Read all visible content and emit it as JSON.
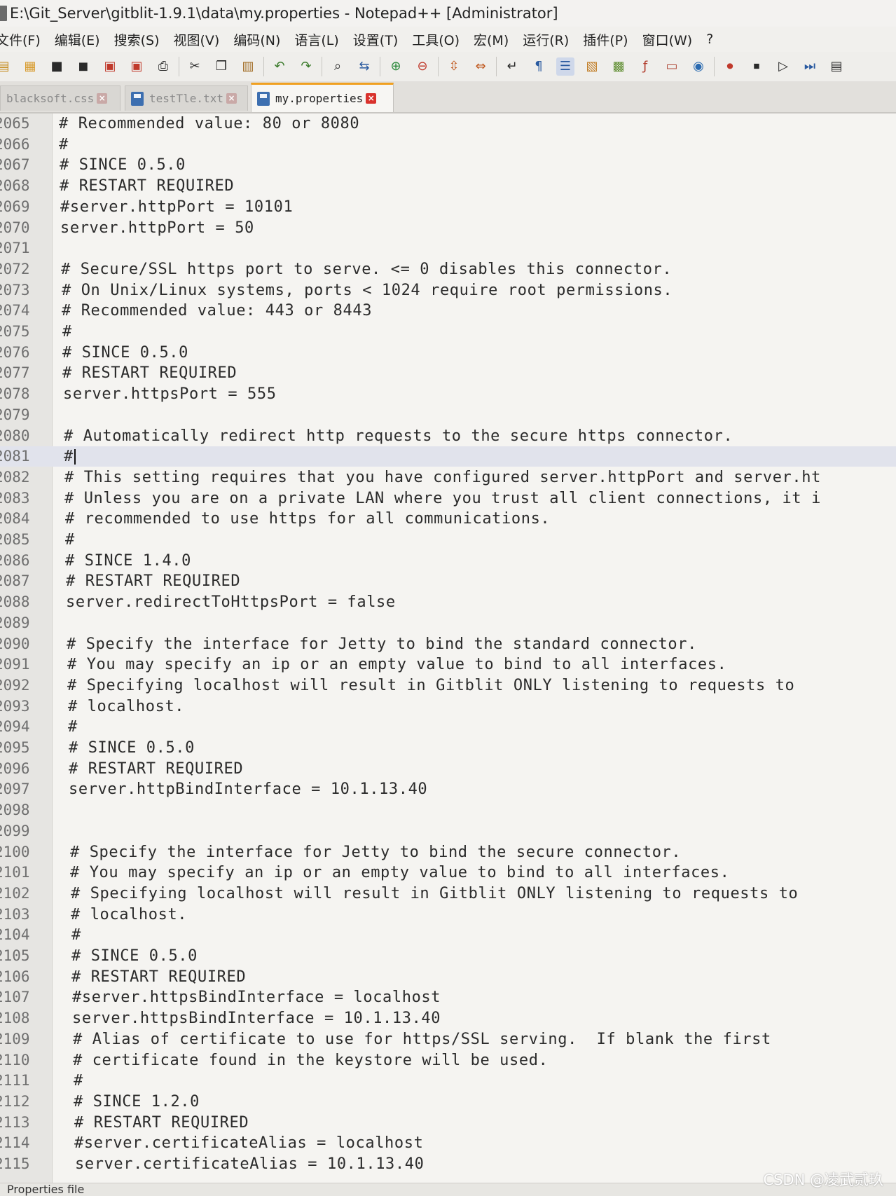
{
  "window": {
    "title": "E:\\Git_Server\\gitblit-1.9.1\\data\\my.properties - Notepad++ [Administrator]"
  },
  "menu": [
    "文件(F)",
    "编辑(E)",
    "搜索(S)",
    "视图(V)",
    "编码(N)",
    "语言(L)",
    "设置(T)",
    "工具(O)",
    "宏(M)",
    "运行(R)",
    "插件(P)",
    "窗口(W)",
    "?"
  ],
  "toolbar": {
    "icons": [
      "new-file-icon",
      "open-file-icon",
      "save-icon",
      "save-all-icon",
      "close-icon",
      "close-all-icon",
      "print-icon",
      "cut-icon",
      "copy-icon",
      "paste-icon",
      "undo-icon",
      "redo-icon",
      "find-icon",
      "replace-icon",
      "zoom-in-icon",
      "zoom-out-icon",
      "sync-vertical-icon",
      "sync-horizontal-icon",
      "word-wrap-icon",
      "show-all-chars-icon",
      "indent-guide-icon",
      "document-map-icon",
      "function-list-icon",
      "folder-workspace-icon",
      "monitoring-icon",
      "record-macro-icon",
      "stop-record-icon",
      "play-macro-icon",
      "run-macro-multiple-icon",
      "save-macro-icon"
    ]
  },
  "tabs": [
    {
      "label": "blacksoft.css",
      "active": false
    },
    {
      "label": "testTle.txt",
      "active": false
    },
    {
      "label": "my.properties",
      "active": true
    }
  ],
  "editor": {
    "current_line": "2081",
    "lines": [
      {
        "n": "2065",
        "text": "# Recommended value: 80 or 8080"
      },
      {
        "n": "2066",
        "text": "#"
      },
      {
        "n": "2067",
        "text": "# SINCE 0.5.0"
      },
      {
        "n": "2068",
        "text": "# RESTART REQUIRED"
      },
      {
        "n": "2069",
        "text": "#server.httpPort = 10101"
      },
      {
        "n": "2070",
        "text": "server.httpPort = 50"
      },
      {
        "n": "2071",
        "text": ""
      },
      {
        "n": "2072",
        "text": "# Secure/SSL https port to serve. <= 0 disables this connector."
      },
      {
        "n": "2073",
        "text": "# On Unix/Linux systems, ports < 1024 require root permissions."
      },
      {
        "n": "2074",
        "text": "# Recommended value: 443 or 8443"
      },
      {
        "n": "2075",
        "text": "#"
      },
      {
        "n": "2076",
        "text": "# SINCE 0.5.0"
      },
      {
        "n": "2077",
        "text": "# RESTART REQUIRED"
      },
      {
        "n": "2078",
        "text": "server.httpsPort = 555"
      },
      {
        "n": "2079",
        "text": ""
      },
      {
        "n": "2080",
        "text": "# Automatically redirect http requests to the secure https connector."
      },
      {
        "n": "2081",
        "text": "#"
      },
      {
        "n": "2082",
        "text": "# This setting requires that you have configured server.httpPort and server.ht"
      },
      {
        "n": "2083",
        "text": "# Unless you are on a private LAN where you trust all client connections, it i"
      },
      {
        "n": "2084",
        "text": "# recommended to use https for all communications."
      },
      {
        "n": "2085",
        "text": "#"
      },
      {
        "n": "2086",
        "text": "# SINCE 1.4.0"
      },
      {
        "n": "2087",
        "text": "# RESTART REQUIRED"
      },
      {
        "n": "2088",
        "text": "server.redirectToHttpsPort = false"
      },
      {
        "n": "2089",
        "text": ""
      },
      {
        "n": "2090",
        "text": "# Specify the interface for Jetty to bind the standard connector."
      },
      {
        "n": "2091",
        "text": "# You may specify an ip or an empty value to bind to all interfaces."
      },
      {
        "n": "2092",
        "text": "# Specifying localhost will result in Gitblit ONLY listening to requests to"
      },
      {
        "n": "2093",
        "text": "# localhost."
      },
      {
        "n": "2094",
        "text": "#"
      },
      {
        "n": "2095",
        "text": "# SINCE 0.5.0"
      },
      {
        "n": "2096",
        "text": "# RESTART REQUIRED"
      },
      {
        "n": "2097",
        "text": "server.httpBindInterface = 10.1.13.40"
      },
      {
        "n": "2098",
        "text": ""
      },
      {
        "n": "2099",
        "text": ""
      },
      {
        "n": "2100",
        "text": "# Specify the interface for Jetty to bind the secure connector."
      },
      {
        "n": "2101",
        "text": "# You may specify an ip or an empty value to bind to all interfaces."
      },
      {
        "n": "2102",
        "text": "# Specifying localhost will result in Gitblit ONLY listening to requests to"
      },
      {
        "n": "2103",
        "text": "# localhost."
      },
      {
        "n": "2104",
        "text": "#"
      },
      {
        "n": "2105",
        "text": "# SINCE 0.5.0"
      },
      {
        "n": "2106",
        "text": "# RESTART REQUIRED"
      },
      {
        "n": "2107",
        "text": "#server.httpsBindInterface = localhost"
      },
      {
        "n": "2108",
        "text": "server.httpsBindInterface = 10.1.13.40"
      },
      {
        "n": "2109",
        "text": "# Alias of certificate to use for https/SSL serving.  If blank the first"
      },
      {
        "n": "2110",
        "text": "# certificate found in the keystore will be used."
      },
      {
        "n": "2111",
        "text": "#"
      },
      {
        "n": "2112",
        "text": "# SINCE 1.2.0"
      },
      {
        "n": "2113",
        "text": "# RESTART REQUIRED"
      },
      {
        "n": "2114",
        "text": "#server.certificateAlias = localhost"
      },
      {
        "n": "2115",
        "text": "server.certificateAlias = 10.1.13.40"
      }
    ]
  },
  "statusbar": {
    "file_type": "Properties file"
  },
  "watermark": "CSDN @凌武贰玖"
}
